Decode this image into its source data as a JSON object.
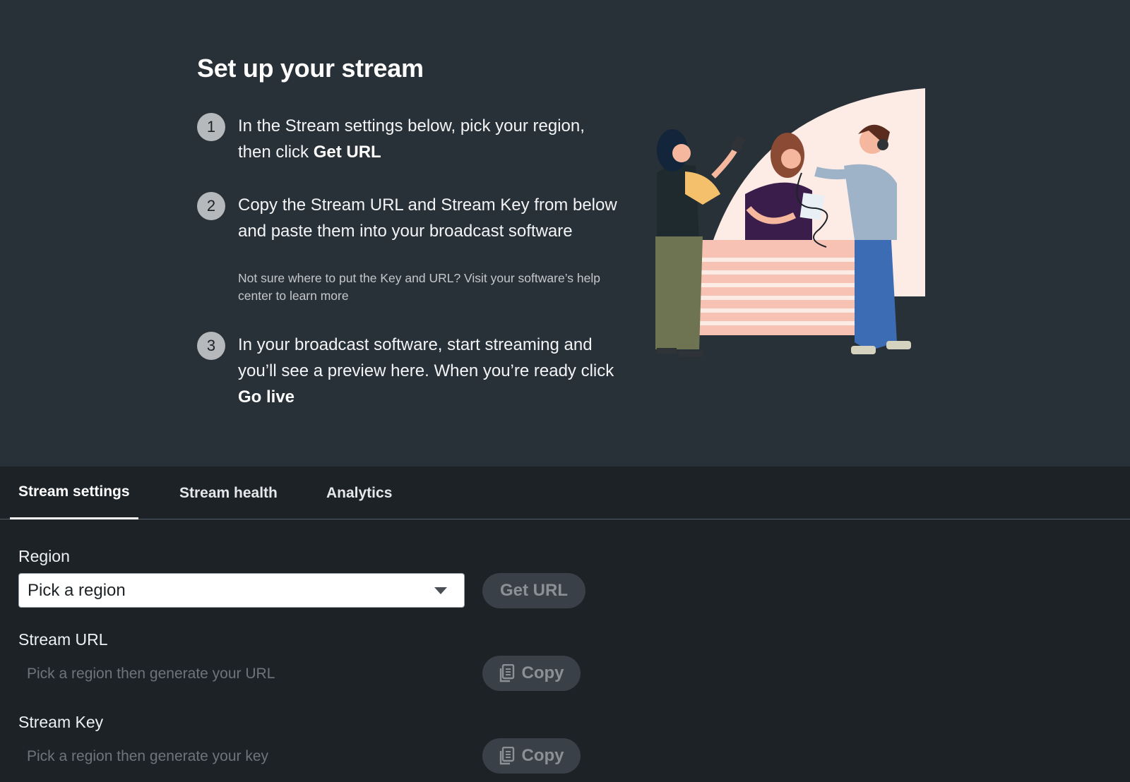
{
  "hero": {
    "title": "Set up your stream",
    "steps": [
      {
        "number": "1",
        "text_before": "In the Stream settings below, pick your region, then click ",
        "text_bold": "Get URL",
        "text_after": ""
      },
      {
        "number": "2",
        "text_before": "Copy the Stream URL and Stream Key from below and paste them into your broadcast software",
        "text_bold": "",
        "text_after": "",
        "hint": "Not sure where to put the Key and URL? Visit your software’s help center to learn more"
      },
      {
        "number": "3",
        "text_before": "In your broadcast software, start streaming and you’ll see a preview here. When you’re ready click ",
        "text_bold": "Go live",
        "text_after": ""
      }
    ]
  },
  "tabs": [
    {
      "label": "Stream settings",
      "active": true
    },
    {
      "label": "Stream health",
      "active": false
    },
    {
      "label": "Analytics",
      "active": false
    }
  ],
  "settings": {
    "region_label": "Region",
    "region_value": "Pick a region",
    "get_url_label": "Get URL",
    "stream_url_label": "Stream URL",
    "stream_url_placeholder": "Pick a region then generate your URL",
    "stream_key_label": "Stream Key",
    "stream_key_placeholder": "Pick a region then generate your key",
    "copy_label": "Copy"
  },
  "icons": {
    "caret": "chevron-down-icon",
    "copy": "copy-document-icon"
  },
  "colors": {
    "hero_bg": "#283038",
    "page_bg": "#1d2226",
    "button_bg": "#3a4047",
    "button_text": "#8a9096",
    "illustration_peach": "#f7c2b4",
    "illustration_pink_bg": "#fdebe6"
  }
}
